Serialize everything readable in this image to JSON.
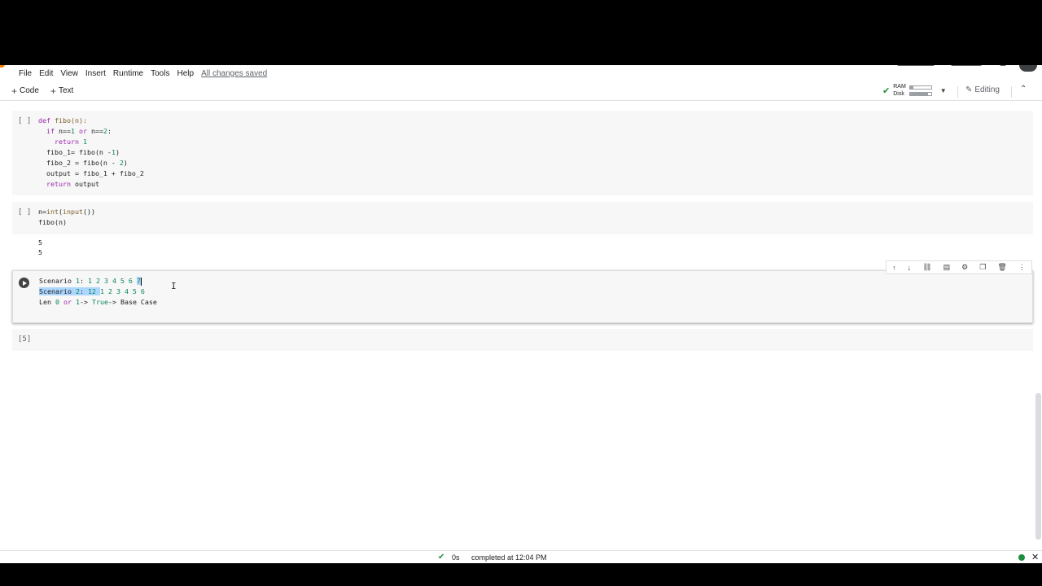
{
  "menu": {
    "items": [
      "File",
      "Edit",
      "View",
      "Insert",
      "Runtime",
      "Tools",
      "Help"
    ],
    "save_status": "All changes saved"
  },
  "toolbar": {
    "add_code": "Code",
    "add_text": "Text",
    "ram_label": "RAM",
    "disk_label": "Disk",
    "editing_label": "Editing"
  },
  "cells": [
    {
      "prompt": "[ ]",
      "code_lines": [
        "def fibo(n):",
        "  if n==1 or n==2:",
        "    return 1",
        "  fibo_1= fibo(n -1)",
        "  fibo_2 = fibo(n - 2)",
        "  output = fibo_1 + fibo_2",
        "  return output"
      ]
    },
    {
      "prompt": "[ ]",
      "code_lines": [
        "n=int(input())",
        "fibo(n)"
      ],
      "output_lines": [
        "5",
        "5"
      ]
    },
    {
      "prompt": "",
      "code_lines": [
        "Scenario 1: 1 2 3 4 5 6 7",
        "Scenario 2: 12 1 2 3 4 5 6",
        "Len 0 or 1-> True-> Base Case"
      ]
    },
    {
      "prompt": "[5]"
    }
  ],
  "cell_toolbar": {
    "icons": [
      "move-up-icon",
      "move-down-icon",
      "link-icon",
      "comment-icon",
      "settings-icon",
      "mirror-icon",
      "delete-icon",
      "more-icon"
    ]
  },
  "status": {
    "elapsed": "0s",
    "message": "completed at 12:04 PM"
  },
  "colors": {
    "accent_green": "#1e8e3e",
    "selection": "#add6ff",
    "keyword": "#9c27b0",
    "number": "#098658"
  }
}
